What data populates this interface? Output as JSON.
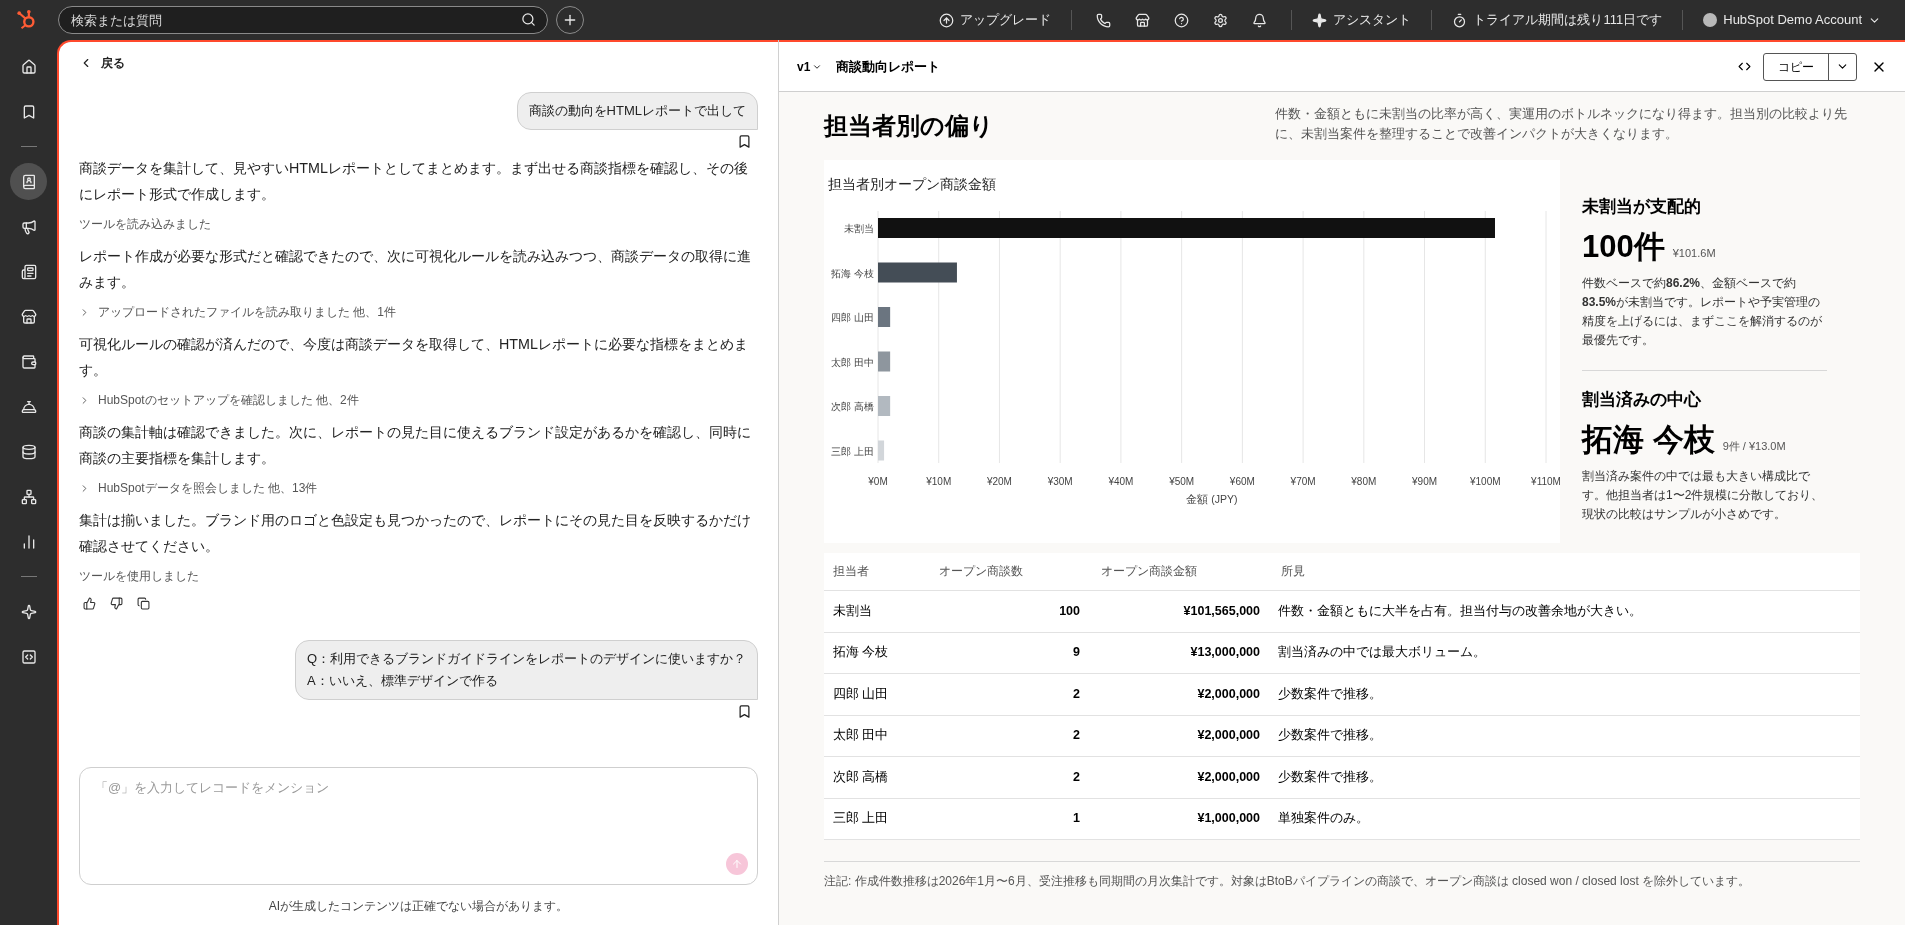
{
  "top_bar": {
    "search": {
      "placeholder": "検索または質問"
    },
    "upgrade": "アップグレード",
    "assistant": "アシスタント",
    "trial": "トライアル期間は残り111日です",
    "account": "HubSpot Demo Account"
  },
  "nav": [
    {
      "kind": "item",
      "selected": false
    },
    {
      "kind": "item",
      "selected": false
    },
    {
      "kind": "divider"
    },
    {
      "kind": "item",
      "selected": true
    },
    {
      "kind": "item",
      "selected": false
    },
    {
      "kind": "item",
      "selected": false
    },
    {
      "kind": "item",
      "selected": false
    },
    {
      "kind": "item",
      "selected": false
    },
    {
      "kind": "item",
      "selected": false
    },
    {
      "kind": "item",
      "selected": false
    },
    {
      "kind": "item",
      "selected": false
    },
    {
      "kind": "item",
      "selected": false
    },
    {
      "kind": "divider"
    },
    {
      "kind": "item",
      "selected": false
    },
    {
      "kind": "item",
      "selected": false
    }
  ],
  "chat": {
    "back": "戻る",
    "messages": [
      {
        "kind": "user",
        "lines": [
          "商談の動向をHTMLレポートで出して"
        ]
      },
      {
        "kind": "assistant",
        "text": "商談データを集計して、見やすいHTMLレポートとしてまとめます。まず出せる商談指標を確認し、その後にレポート形式で作成します。"
      },
      {
        "kind": "tool",
        "text": "ツールを読み込みました"
      },
      {
        "kind": "assistant",
        "text": "レポート作成が必要な形式だと確認できたので、次に可視化ルールを読み込みつつ、商談データの取得に進みます。"
      },
      {
        "kind": "tool_group",
        "text": "アップロードされたファイルを読み取りました 他、1件"
      },
      {
        "kind": "assistant",
        "text": "可視化ルールの確認が済んだので、今度は商談データを取得して、HTMLレポートに必要な指標をまとめます。"
      },
      {
        "kind": "tool_group",
        "text": "HubSpotのセットアップを確認しました 他、2件"
      },
      {
        "kind": "assistant",
        "text": "商談の集計軸は確認できました。次に、レポートの見た目に使えるブランド設定があるかを確認し、同時に商談の主要指標を集計します。"
      },
      {
        "kind": "tool_group",
        "text": "HubSpotデータを照会しました 他、13件"
      },
      {
        "kind": "assistant",
        "text": "集計は揃いました。ブランド用のロゴと色設定も見つかったので、レポートにその見た目を反映するかだけ確認させてください。"
      },
      {
        "kind": "tool",
        "text": "ツールを使用しました"
      },
      {
        "kind": "feedback"
      },
      {
        "kind": "user",
        "lines": [
          "Q：利用できるブランドガイドラインをレポートのデザインに使いますか？",
          "A：いいえ、標準デザインで作る"
        ]
      }
    ],
    "input": {
      "placeholder": "「@」を入力してレコードをメンション"
    },
    "disclaimer": "AIが生成したコンテンツは正確でない場合があります。"
  },
  "report": {
    "version": "v1",
    "title": "商談動向レポート",
    "copy": "コピー",
    "heading": "担当者別の偏り",
    "summary": "件数・金額ともに未割当の比率が高く、実運用のボトルネックになり得ます。担当別の比較より先に、未割当案件を整理することで改善インパクトが大きくなります。",
    "chart_data": {
      "type": "bar",
      "orientation": "horizontal",
      "title": "担当者別オープン商談金額",
      "xlabel": "金額 (JPY)",
      "categories": [
        "未割当",
        "拓海 今枝",
        "四郎 山田",
        "太郎 田中",
        "次郎 高橋",
        "三郎 上田"
      ],
      "values": [
        101.6,
        13,
        2,
        2,
        2,
        1
      ],
      "colors": [
        "#111111",
        "#444d56",
        "#6b7580",
        "#8e969e",
        "#b2b9c0",
        "#d2d6da"
      ],
      "grid": true,
      "xlim": [
        0,
        110
      ],
      "xticks": [
        {
          "value": 0,
          "label": "¥0M"
        },
        {
          "value": 10,
          "label": "¥10M"
        },
        {
          "value": 20,
          "label": "¥20M"
        },
        {
          "value": 30,
          "label": "¥30M"
        },
        {
          "value": 40,
          "label": "¥40M"
        },
        {
          "value": 50,
          "label": "¥50M"
        },
        {
          "value": 60,
          "label": "¥60M"
        },
        {
          "value": 70,
          "label": "¥70M"
        },
        {
          "value": 80,
          "label": "¥80M"
        },
        {
          "value": 90,
          "label": "¥90M"
        },
        {
          "value": 100,
          "label": "¥100M"
        },
        {
          "value": 110,
          "label": "¥110M"
        }
      ]
    },
    "insights": [
      {
        "title": "未割当が支配的",
        "value": "100件",
        "detail": "¥101.6M",
        "text": "件数ベースで約**86.2%**、金額ベースで約**83.5%**が未割当です。レポートや予実管理の精度を上げるには、まずここを解消するのが最優先です。"
      },
      {
        "title": "割当済みの中心",
        "value": "拓海 今枝",
        "detail": "9件 / ¥13.0M",
        "text": "割当済み案件の中では最も大きい構成比です。他担当者は1〜2件規模に分散しており、現状の比較はサンプルが小さめです。"
      }
    ],
    "table": {
      "columns": [
        "担当者",
        "オープン商談数",
        "オープン商談金額",
        "所見"
      ],
      "rows": [
        [
          "未割当",
          "100",
          "¥101,565,000",
          "件数・金額ともに大半を占有。担当付与の改善余地が大きい。"
        ],
        [
          "拓海 今枝",
          "9",
          "¥13,000,000",
          "割当済みの中では最大ボリューム。"
        ],
        [
          "四郎 山田",
          "2",
          "¥2,000,000",
          "少数案件で推移。"
        ],
        [
          "太郎 田中",
          "2",
          "¥2,000,000",
          "少数案件で推移。"
        ],
        [
          "次郎 高橋",
          "2",
          "¥2,000,000",
          "少数案件で推移。"
        ],
        [
          "三郎 上田",
          "1",
          "¥1,000,000",
          "単独案件のみ。"
        ]
      ]
    },
    "note": "注記: 作成件数推移は2026年1月〜6月、受注推移も同期間の月次集計です。対象はBtoBパイプラインの商談で、オープン商談は closed won / closed lost を除外しています。"
  }
}
